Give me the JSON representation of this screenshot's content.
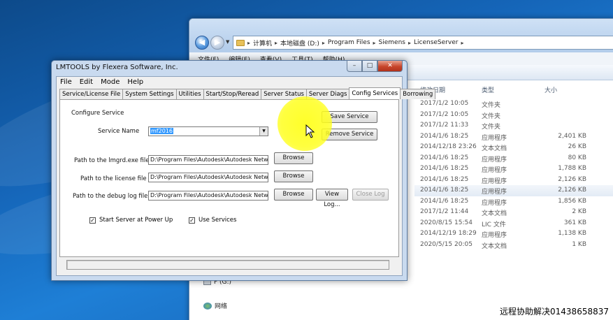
{
  "explorer": {
    "breadcrumbs": [
      "计算机",
      "本地磁盘 (D:)",
      "Program Files",
      "Siemens",
      "LicenseServer"
    ],
    "menu": [
      "文件(F)",
      "编辑(E)",
      "查看(V)",
      "工具(T)",
      "帮助(H)"
    ],
    "columns": {
      "date": "修改日期",
      "type": "类型",
      "size": "大小"
    },
    "rows": [
      {
        "date": "2017/1/2 10:05",
        "type": "文件夹",
        "size": ""
      },
      {
        "date": "2017/1/2 10:05",
        "type": "文件夹",
        "size": ""
      },
      {
        "date": "2017/1/2 11:33",
        "type": "文件夹",
        "size": ""
      },
      {
        "date": "2014/1/6 18:25",
        "type": "应用程序",
        "size": "2,401 KB"
      },
      {
        "date": "2014/12/18 23:26",
        "type": "文本文档",
        "size": "26 KB"
      },
      {
        "date": "2014/1/6 18:25",
        "type": "应用程序",
        "size": "80 KB"
      },
      {
        "date": "2014/1/6 18:25",
        "type": "应用程序",
        "size": "1,788 KB"
      },
      {
        "date": "2014/1/6 18:25",
        "type": "应用程序",
        "size": "2,126 KB"
      },
      {
        "date": "2014/1/6 18:25",
        "type": "应用程序",
        "size": "2,126 KB"
      },
      {
        "date": "2014/1/6 18:25",
        "type": "应用程序",
        "size": "1,856 KB"
      },
      {
        "date": "2017/1/2 11:44",
        "type": "文本文档",
        "size": "2 KB"
      },
      {
        "date": "2020/8/15 15:54",
        "type": "LIC 文件",
        "size": "361 KB"
      },
      {
        "date": "2014/12/19 18:29",
        "type": "应用程序",
        "size": "1,138 KB"
      },
      {
        "date": "2020/5/15 20:05",
        "type": "文本文档",
        "size": "1 KB"
      }
    ],
    "nav_pane": {
      "drive_f": "F (G:)",
      "network": "网络"
    }
  },
  "lmtools": {
    "title": "LMTOOLS by Flexera Software, Inc.",
    "menu": [
      "File",
      "Edit",
      "Mode",
      "Help"
    ],
    "tabs": [
      "Service/License File",
      "System Settings",
      "Utilities",
      "Start/Stop/Reread",
      "Server Status",
      "Server Diags",
      "Config Services",
      "Borrowing"
    ],
    "active_tab": "Config Services",
    "configure_service_label": "Configure Service",
    "service_name_label": "Service Name",
    "service_name_value": "mf2016",
    "save_service": "Save Service",
    "remove_service": "Remove Service",
    "lmgrd_label": "Path to the lmgrd.exe file",
    "lmgrd_value": "D:\\Program Files\\Autodesk\\Autodesk Network l",
    "license_label": "Path to the license file",
    "license_value": "D:\\Program Files\\Autodesk\\Autodesk Network l",
    "debug_label": "Path to the debug log file",
    "debug_value": "D:\\Program Files\\Autodesk\\Autodesk Network l",
    "browse": "Browse",
    "view_log": "View Log...",
    "close_log": "Close Log",
    "start_at_power_up": "Start Server at Power Up",
    "use_services": "Use Services"
  },
  "watermark": "远程协助解决01438658837"
}
